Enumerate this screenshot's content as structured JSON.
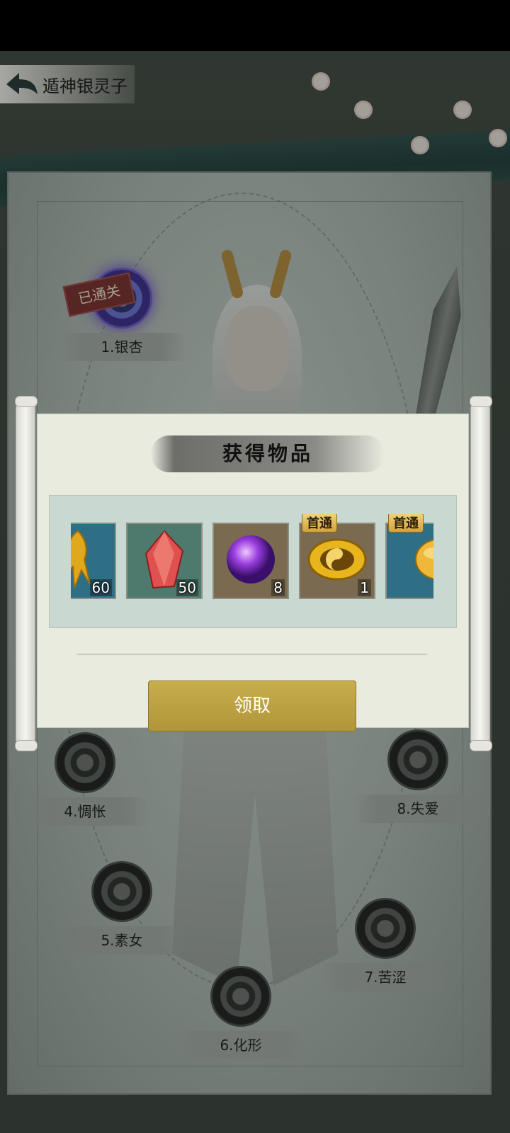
{
  "header": {
    "title": "遁神银灵子",
    "back_icon": "back-arrow-icon"
  },
  "stages": [
    {
      "label": "1.银杏",
      "status": "已通关"
    },
    {
      "label": "4.惆怅"
    },
    {
      "label": "5.素女"
    },
    {
      "label": "6.化形"
    },
    {
      "label": "7.苦涩"
    },
    {
      "label": "8.失爱"
    }
  ],
  "dialog": {
    "title": "获得物品",
    "claim_label": "领取",
    "items": [
      {
        "icon": "golden-ginseng-icon",
        "count": "60",
        "bg": "#2f6f86"
      },
      {
        "icon": "red-crystal-icon",
        "count": "50",
        "bg": "#4d7a6d"
      },
      {
        "icon": "purple-orb-icon",
        "count": "8",
        "bg": "#7a6a4f"
      },
      {
        "icon": "golden-coin-icon",
        "count": "1",
        "bg": "#7a6a4f",
        "badge": "首通"
      },
      {
        "icon": "gold-ingot-icon",
        "count": "",
        "bg": "#2f6f86",
        "badge": "首通"
      }
    ]
  },
  "colors": {
    "button": "#b89c40",
    "dialog_bg": "#e9ebdf",
    "stamp": "#7a2d2d"
  }
}
